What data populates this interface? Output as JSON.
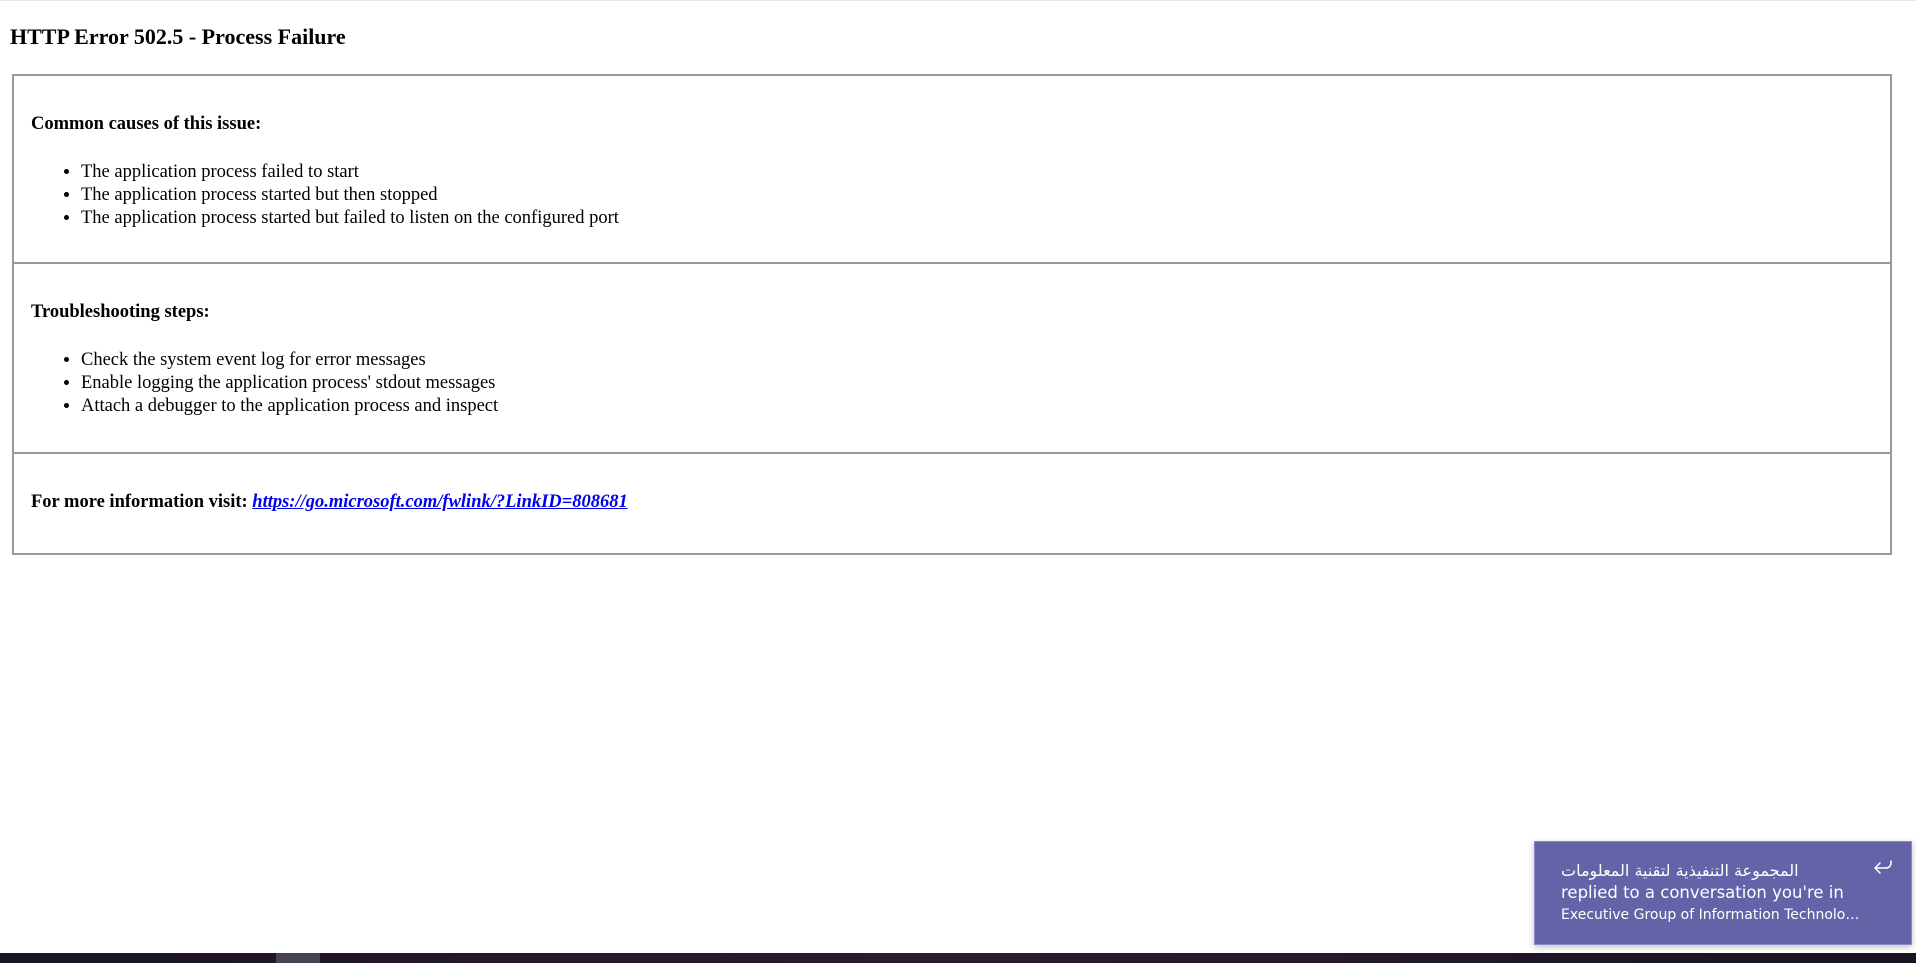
{
  "page": {
    "title": "HTTP Error 502.5 - Process Failure"
  },
  "sections": {
    "causes": {
      "heading": "Common causes of this issue:",
      "items": [
        "The application process failed to start",
        "The application process started but then stopped",
        "The application process started but failed to listen on the configured port"
      ]
    },
    "steps": {
      "heading": "Troubleshooting steps:",
      "items": [
        "Check the system event log for error messages",
        "Enable logging the application process' stdout messages",
        "Attach a debugger to the application process and inspect"
      ]
    },
    "info": {
      "label": "For more information visit:",
      "link_text": "https://go.microsoft.com/fwlink/?LinkID=808681"
    }
  },
  "notification": {
    "sender": "المجموعة التنفيذية لتقنية المعلومات",
    "message": "replied to a conversation you're in",
    "channel": "Executive Group of Information Technolog...",
    "icon": "reply-icon",
    "background_color": "#6264a7"
  },
  "colors": {
    "link": "#0000ee",
    "panel_border": "#9a9a9a"
  }
}
